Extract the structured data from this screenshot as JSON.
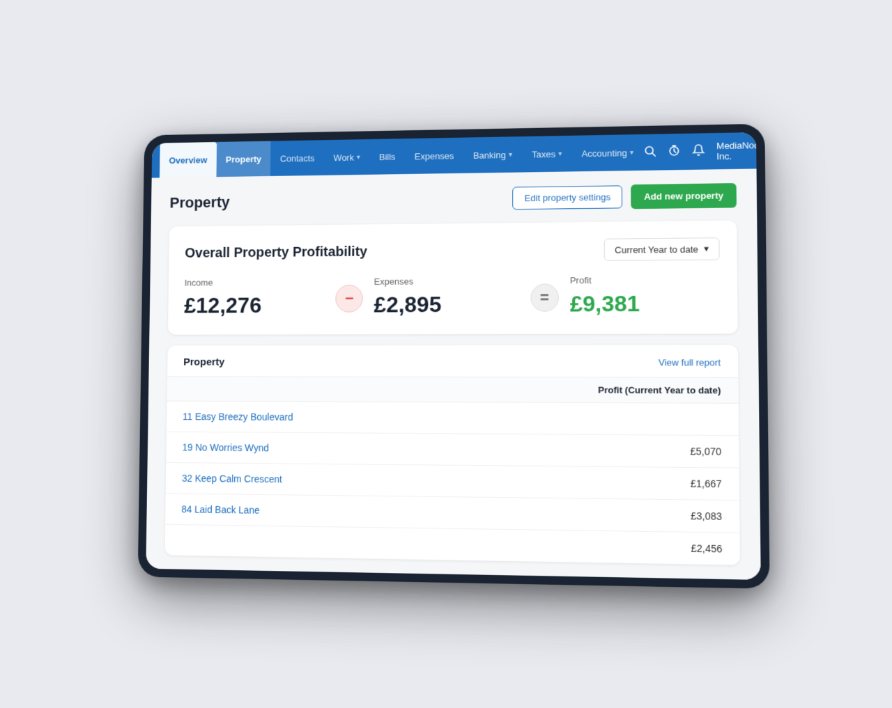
{
  "nav": {
    "items": [
      {
        "id": "overview",
        "label": "Overview",
        "active": true,
        "hasArrow": false
      },
      {
        "id": "property",
        "label": "Property",
        "active": false,
        "hasArrow": false,
        "propertyActive": true
      },
      {
        "id": "contacts",
        "label": "Contacts",
        "active": false,
        "hasArrow": false
      },
      {
        "id": "work",
        "label": "Work",
        "active": false,
        "hasArrow": true
      },
      {
        "id": "bills",
        "label": "Bills",
        "active": false,
        "hasArrow": false
      },
      {
        "id": "expenses",
        "label": "Expenses",
        "active": false,
        "hasArrow": false
      },
      {
        "id": "banking",
        "label": "Banking",
        "active": false,
        "hasArrow": true
      },
      {
        "id": "taxes",
        "label": "Taxes",
        "active": false,
        "hasArrow": true
      },
      {
        "id": "accounting",
        "label": "Accounting",
        "active": false,
        "hasArrow": true
      }
    ],
    "company": "MediaNode Inc.",
    "search_icon": "🔍",
    "timer_icon": "⏱",
    "bell_icon": "🔔"
  },
  "page": {
    "title": "Property",
    "edit_settings_label": "Edit property settings",
    "add_new_label": "Add new property"
  },
  "profitability": {
    "title": "Overall Property Profitability",
    "period_label": "Current Year to date",
    "income_label": "Income",
    "income_value": "£12,276",
    "expenses_label": "Expenses",
    "expenses_value": "£2,895",
    "profit_label": "Profit",
    "profit_value": "£9,381",
    "minus_operator": "−",
    "equals_operator": "="
  },
  "property_table": {
    "section_title": "Property",
    "profit_col_header": "Profit (Current Year to date)",
    "view_report_label": "View full report",
    "properties": [
      {
        "id": 1,
        "name": "11 Easy Breezy Boulevard",
        "profit": ""
      },
      {
        "id": 2,
        "name": "19 No Worries Wynd",
        "profit": "£5,070"
      },
      {
        "id": 3,
        "name": "32 Keep Calm Crescent",
        "profit": "£1,667"
      },
      {
        "id": 4,
        "name": "84 Laid Back Lane",
        "profit": "£3,083"
      },
      {
        "id": 5,
        "name": "",
        "profit": "£2,456"
      }
    ]
  }
}
